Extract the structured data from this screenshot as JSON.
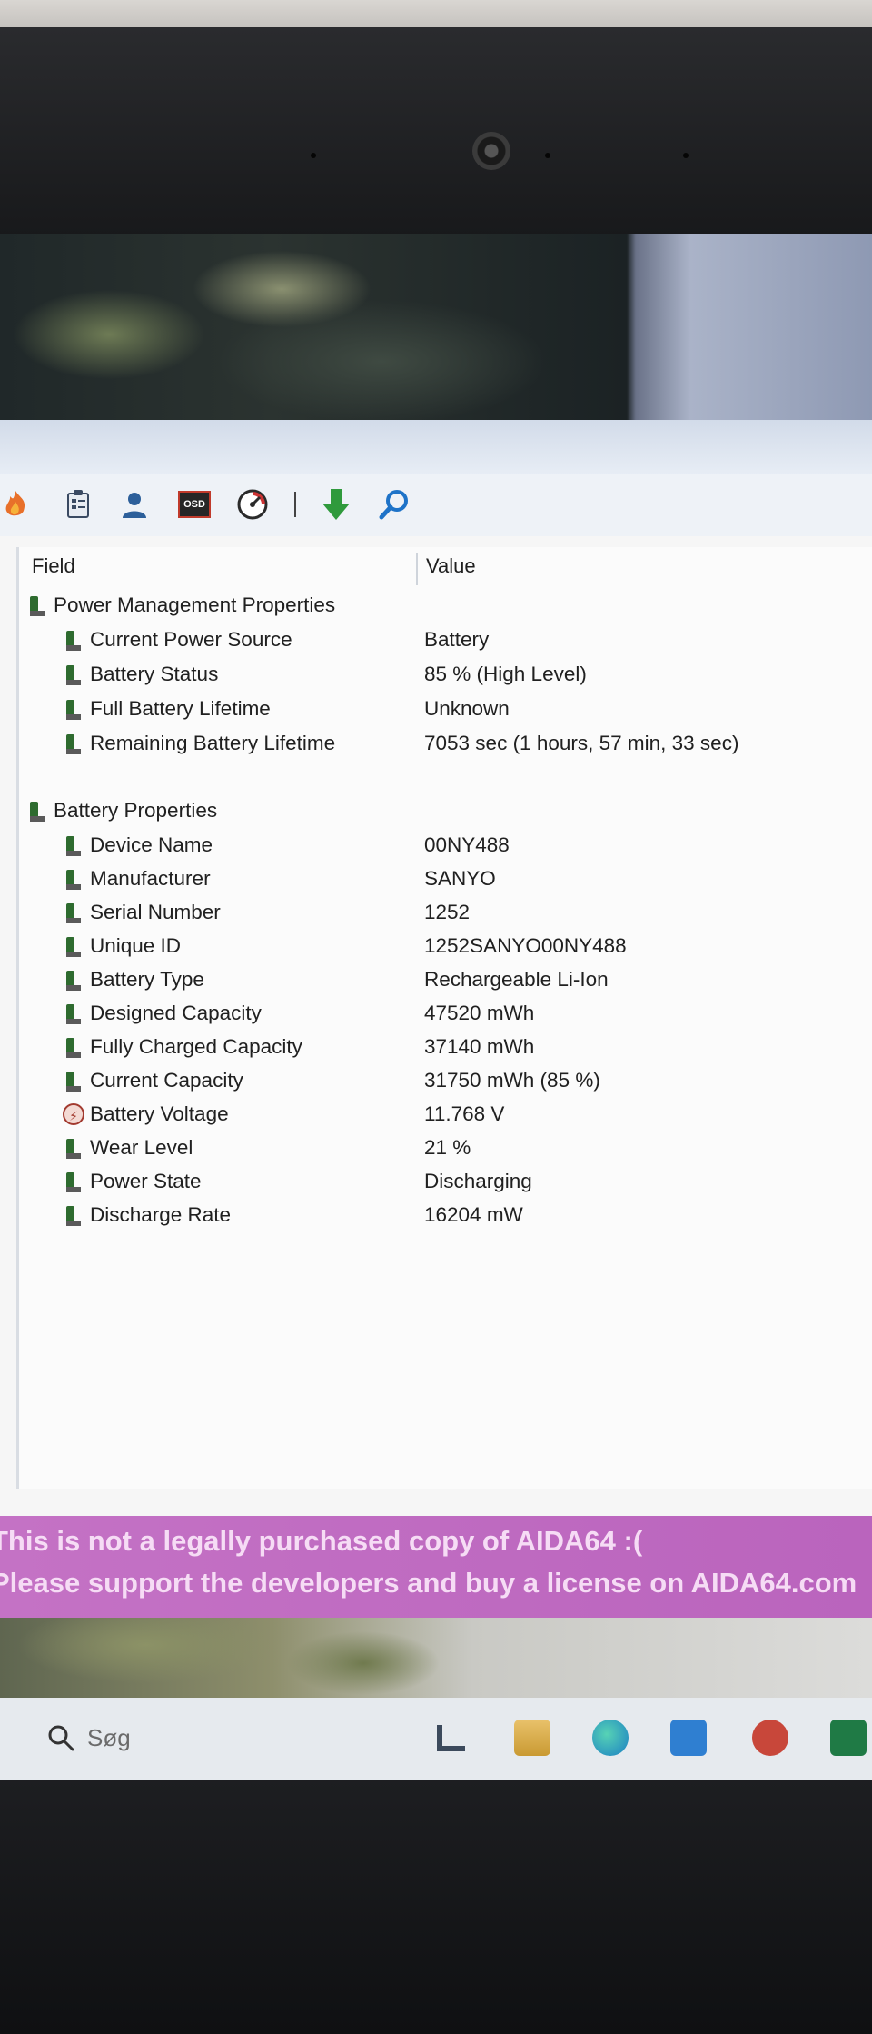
{
  "table": {
    "col_field": "Field",
    "col_value": "Value",
    "groups": [
      {
        "title": "Power Management Properties",
        "rows": [
          {
            "field": "Current Power Source",
            "value": "Battery"
          },
          {
            "field": "Battery Status",
            "value": "85 % (High Level)"
          },
          {
            "field": "Full Battery Lifetime",
            "value": "Unknown"
          },
          {
            "field": "Remaining Battery Lifetime",
            "value": "7053 sec (1 hours, 57 min, 33 sec)"
          }
        ]
      },
      {
        "title": "Battery Properties",
        "rows": [
          {
            "field": "Device Name",
            "value": "00NY488"
          },
          {
            "field": "Manufacturer",
            "value": "SANYO"
          },
          {
            "field": "Serial Number",
            "value": "1252"
          },
          {
            "field": "Unique ID",
            "value": "1252SANYO00NY488"
          },
          {
            "field": "Battery Type",
            "value": "Rechargeable Li-Ion"
          },
          {
            "field": "Designed Capacity",
            "value": "47520 mWh"
          },
          {
            "field": "Fully Charged Capacity",
            "value": "37140 mWh"
          },
          {
            "field": "Current Capacity",
            "value": "31750 mWh  (85 %)"
          },
          {
            "field": "Battery Voltage",
            "value": "11.768 V"
          },
          {
            "field": "Wear Level",
            "value": "21 %"
          },
          {
            "field": "Power State",
            "value": "Discharging"
          },
          {
            "field": "Discharge Rate",
            "value": "16204 mW"
          }
        ]
      }
    ]
  },
  "toolbar": {
    "osd_label": "OSD"
  },
  "banner": {
    "line1": "This is not a legally purchased copy of AIDA64 :(",
    "line2": "Please support the developers and buy a license on AIDA64.com"
  },
  "taskbar": {
    "search_placeholder": "Søg"
  },
  "icons": {
    "row_icon": "battery-icon",
    "voltage_icon": "voltage-icon",
    "toolbar": [
      "flame-icon",
      "report-icon",
      "user-icon",
      "osd-icon",
      "gauge-icon",
      "download-arrow-icon",
      "search-icon"
    ]
  },
  "colors": {
    "banner": "#c472c5",
    "battery_green": "#2e6b2f",
    "download_green": "#2f9a3c",
    "search_blue": "#1e73c8"
  }
}
